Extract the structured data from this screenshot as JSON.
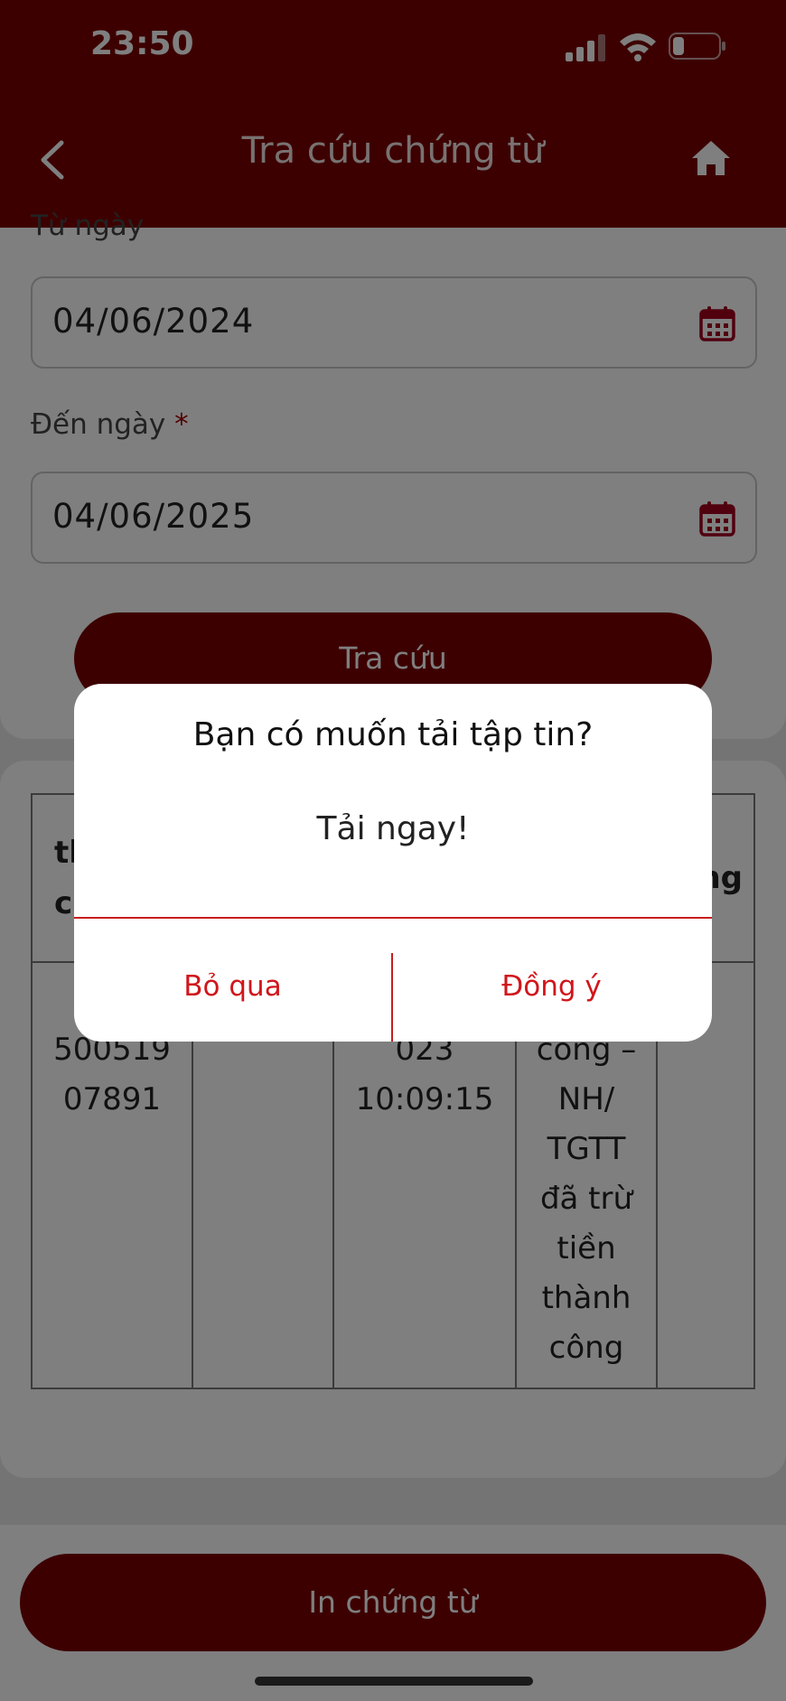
{
  "status_bar": {
    "time": "23:50"
  },
  "header": {
    "title": "Tra cứu chứng từ"
  },
  "form": {
    "from_label": "Từ ngày",
    "from_date": "04/06/2024",
    "to_label": "Đến ngày",
    "to_required_mark": "*",
    "to_date": "04/06/2025",
    "search_label": "Tra cứu"
  },
  "table": {
    "headers": [
      "th\nc",
      "",
      "",
      "",
      "ng"
    ],
    "row": [
      "11\n500519\n07891",
      "",
      "\n023\n10:09:15",
      "\ncông –\nNH/\nTGTT\nđã trừ\ntiền\nthành\ncông",
      ""
    ]
  },
  "footer": {
    "print_label": "In chứng từ"
  },
  "dialog": {
    "title": "Bạn có muốn tải tập tin?",
    "message": "Tải ngay!",
    "cancel_label": "Bỏ qua",
    "confirm_label": "Đồng ý"
  },
  "colors": {
    "brand": "#7a0000",
    "accent": "#d0161c"
  }
}
